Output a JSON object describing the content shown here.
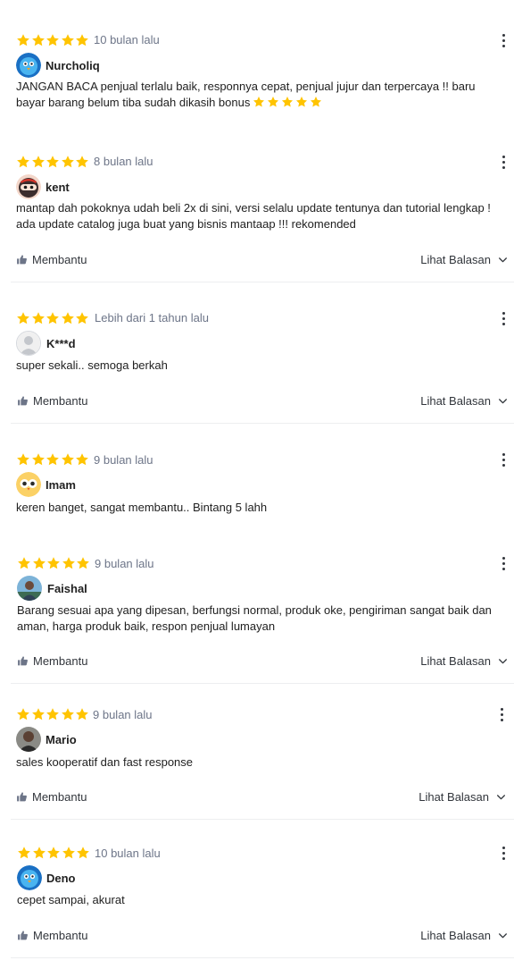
{
  "colors": {
    "star": "#ffc400",
    "muted": "#6d7588",
    "text": "#212121",
    "divider": "#edeef0"
  },
  "icons": {
    "star": "star-icon",
    "menu": "more-vertical-icon",
    "helpful": "thumbs-up-icon",
    "chevron": "chevron-down-icon"
  },
  "reviews": [
    {
      "rating": 5,
      "time": "10 bulan lalu",
      "user": "Nurcholiq",
      "avatar": "blue-bird-avatar",
      "text": "JANGAN BACA penjual terlalu baik, responnya cepat, penjual jujur dan terpercaya !! baru bayar barang belum tiba sudah dikasih bonus",
      "emoji_stars": 5
    },
    {
      "rating": 5,
      "time": "8 bulan lalu",
      "user": "kent",
      "avatar": "ninja-avatar",
      "text": "mantap dah pokoknya udah beli 2x di sini, versi selalu update tentunya dan tutorial lengkap ! ada update catalog juga buat yang bisnis mantaap !!! rekomended",
      "helpful": "Membantu",
      "replies": "Lihat Balasan"
    },
    {
      "rating": 5,
      "time": "Lebih dari 1 tahun lalu",
      "user": "K***d",
      "avatar": "default-avatar",
      "text": "super sekali.. semoga berkah",
      "helpful": "Membantu",
      "replies": "Lihat Balasan"
    },
    {
      "rating": 5,
      "time": "9 bulan lalu",
      "user": "Imam",
      "avatar": "owl-avatar",
      "text": "keren banget, sangat membantu.. Bintang 5 lahh"
    },
    {
      "rating": 5,
      "time": "9 bulan lalu",
      "user": "Faishal",
      "avatar": "photo-avatar",
      "text": "Barang sesuai apa yang dipesan, berfungsi normal, produk oke, pengiriman sangat baik dan aman, harga produk baik, respon penjual lumayan",
      "helpful": "Membantu",
      "replies": "Lihat Balasan"
    },
    {
      "rating": 5,
      "time": "9 bulan lalu",
      "user": "Mario",
      "avatar": "photo-avatar",
      "text": "sales kooperatif dan fast response",
      "helpful": "Membantu",
      "replies": "Lihat Balasan"
    },
    {
      "rating": 5,
      "time": "10 bulan lalu",
      "user": "Deno",
      "avatar": "blue-bird-avatar",
      "text": "cepet sampai, akurat",
      "helpful": "Membantu",
      "replies": "Lihat Balasan"
    }
  ]
}
